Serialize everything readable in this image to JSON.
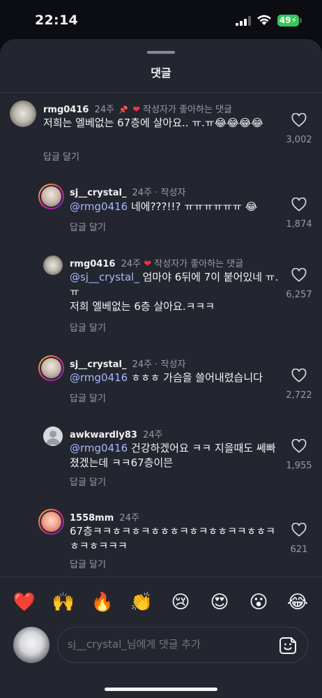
{
  "status_bar": {
    "time": "22:14",
    "battery": "49"
  },
  "sheet": {
    "title": "댓글"
  },
  "comments": [
    {
      "username": "rmg0416",
      "time": "24주",
      "tag": "작성자가 좋아하는 댓글",
      "text": "저희는 엘베없는 67층에 살아요.. ㅠ.ㅠ😂😂😂😂",
      "reply": "답글 달기",
      "likes": "3,002",
      "pinned": true
    },
    {
      "username": "sj__crystal_",
      "time": "24주",
      "tag": "· 작성자",
      "mention": "@rmg0416",
      "text": " 네에???!!? ㅠㅠㅠㅠㅠㅠ 😂",
      "reply": "답글 달기",
      "likes": "1,874"
    },
    {
      "username": "rmg0416",
      "time": "24주",
      "tag": "작성자가 좋아하는 댓글",
      "mention": "@sj__crystal_",
      "text": " 엄마야 6뒤에 7이 붙어있네 ㅠ.ㅠ",
      "text2": "저희 엘베없는 6층 살아요.ㅋㅋㅋ",
      "reply": "답글 달기",
      "likes": "6,257"
    },
    {
      "username": "sj__crystal_",
      "time": "24주",
      "tag": "· 작성자",
      "mention": "@rmg0416",
      "text": " ㅎㅎㅎ 가슴을 쓸어내렸습니다",
      "reply": "답글 달기",
      "likes": "2,722"
    },
    {
      "username": "awkwardly83",
      "time": "24주",
      "mention": "@rmg0416",
      "text": " 건강하겠어요 ㅋㅋ 지을때도 쎄빠졌겠는데 ㅋㅋ67층이믄",
      "reply": "답글 달기",
      "likes": "1,955"
    },
    {
      "username": "1558mm",
      "time": "24주",
      "text": "67층ㅋㅋㅎㅋㅎㅋㅎㅎㅎㅋㅎㅋㅎㅎㅋㅋㅎㅎㅋㅎㅋㅎㅋㅋㅋ",
      "reply": "답글 달기",
      "likes": "621"
    }
  ],
  "quick_emojis": [
    "❤️",
    "🙌",
    "🔥",
    "👏",
    "😢",
    "😍",
    "😮",
    "😂"
  ],
  "input": {
    "placeholder": "sj__crystal_님에게 댓글 추가"
  },
  "colors": {
    "accent_heart": "#ff3040",
    "mention": "#a4b8ff",
    "sheet_bg": "#24262f"
  }
}
